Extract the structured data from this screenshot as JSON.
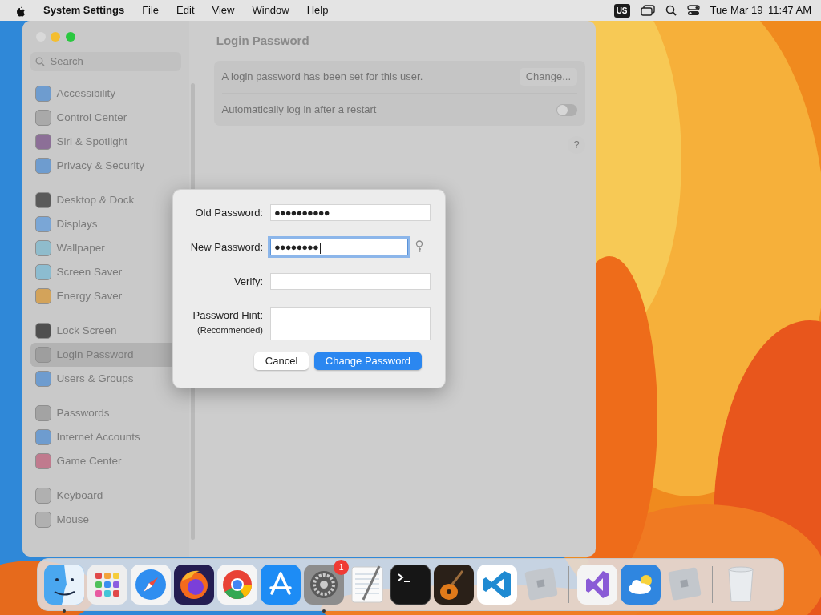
{
  "menubar": {
    "app_name": "System Settings",
    "menus": [
      "File",
      "Edit",
      "View",
      "Window",
      "Help"
    ],
    "input_source": "US",
    "date": "Tue Mar 19",
    "time": "11:47 AM"
  },
  "window": {
    "title": "Login Password",
    "search": {
      "placeholder": "Search"
    },
    "sidebar_sections": [
      {
        "items": [
          {
            "label": "Accessibility",
            "color": "#6e9ccf",
            "selected": false
          },
          {
            "label": "Control Center",
            "color": "#a9a9a9",
            "selected": false
          },
          {
            "label": "Siri & Spotlight",
            "color": "#8c6f97",
            "selected": false
          },
          {
            "label": "Privacy & Security",
            "color": "#6e9ccf",
            "selected": false
          }
        ]
      },
      {
        "items": [
          {
            "label": "Desktop & Dock",
            "color": "#5a5a5a",
            "selected": false
          },
          {
            "label": "Displays",
            "color": "#7aa6d6",
            "selected": false
          },
          {
            "label": "Wallpaper",
            "color": "#8fbccc",
            "selected": false
          },
          {
            "label": "Screen Saver",
            "color": "#8cbcd0",
            "selected": false
          },
          {
            "label": "Energy Saver",
            "color": "#d3a35a",
            "selected": false
          }
        ]
      },
      {
        "items": [
          {
            "label": "Lock Screen",
            "color": "#4f4f4f",
            "selected": false
          },
          {
            "label": "Login Password",
            "color": "#9e9e9e",
            "selected": true
          },
          {
            "label": "Users & Groups",
            "color": "#6e9ccf",
            "selected": false
          }
        ]
      },
      {
        "items": [
          {
            "label": "Passwords",
            "color": "#a3a3a3",
            "selected": false
          },
          {
            "label": "Internet Accounts",
            "color": "#6e9ccf",
            "selected": false
          },
          {
            "label": "Game Center",
            "color": "#c07a8e",
            "selected": false
          }
        ]
      },
      {
        "items": [
          {
            "label": "Keyboard",
            "color": "#b0b0b0",
            "selected": false
          },
          {
            "label": "Mouse",
            "color": "#b0b0b0",
            "selected": false
          }
        ]
      }
    ],
    "content": {
      "status_text": "A login password has been set for this user.",
      "change_button": "Change...",
      "auto_login": {
        "label": "Automatically log in after a restart",
        "on": false
      },
      "help_button": "?"
    }
  },
  "dialog": {
    "fields": [
      {
        "kind": "single",
        "label": "Old Password:",
        "value": "●●●●●●●●●●",
        "focused": false,
        "assistant": false
      },
      {
        "kind": "single",
        "label": "New Password:",
        "value": "●●●●●●●●",
        "focused": true,
        "assistant": true
      },
      {
        "kind": "single",
        "label": "Verify:",
        "focused": false,
        "assistant": false
      },
      {
        "kind": "multi",
        "label": "Password Hint:",
        "sublabel": "(Recommended)",
        "focused": false,
        "assistant": false
      }
    ],
    "buttons": [
      {
        "label": "Cancel",
        "default": false
      },
      {
        "label": "Change Password",
        "default": true
      }
    ]
  },
  "dock": {
    "groups": [
      [
        {
          "running": true
        },
        {
          "running": false
        },
        {
          "running": false
        },
        {
          "running": false
        },
        {
          "running": false
        },
        {
          "running": false
        },
        {
          "running": true,
          "badge": "1"
        },
        {
          "running": false
        },
        {
          "running": false
        },
        {
          "running": false
        },
        {
          "running": false
        },
        {
          "running": false
        }
      ],
      [
        {
          "running": false
        },
        {
          "running": false
        },
        {
          "running": false
        }
      ],
      [
        {
          "running": false
        }
      ]
    ]
  }
}
